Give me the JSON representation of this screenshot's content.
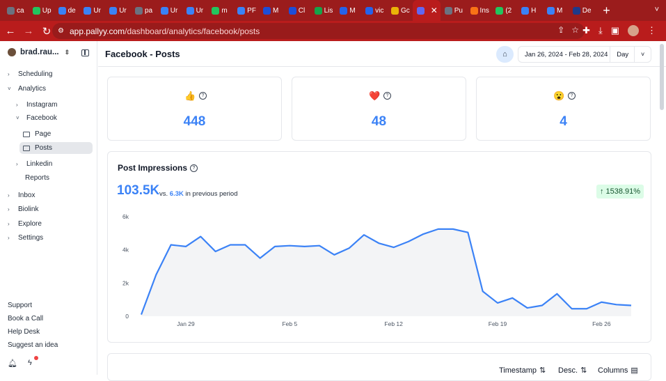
{
  "browser": {
    "tabs": [
      {
        "label": "ca",
        "color": "#6b7280"
      },
      {
        "label": "Up",
        "color": "#22c55e"
      },
      {
        "label": "de",
        "color": "#3b82f6"
      },
      {
        "label": "Ur",
        "color": "#3b82f6"
      },
      {
        "label": "Ur",
        "color": "#3b82f6"
      },
      {
        "label": "pa",
        "color": "#6b7280"
      },
      {
        "label": "Ur",
        "color": "#3b82f6"
      },
      {
        "label": "Ur",
        "color": "#3b82f6"
      },
      {
        "label": "m",
        "color": "#22c55e"
      },
      {
        "label": "PF",
        "color": "#3b82f6"
      },
      {
        "label": "M",
        "color": "#1d4ed8"
      },
      {
        "label": "Cl",
        "color": "#1d4ed8"
      },
      {
        "label": "Lis",
        "color": "#16a34a"
      },
      {
        "label": "M",
        "color": "#2563eb"
      },
      {
        "label": "vic",
        "color": "#2563eb"
      },
      {
        "label": "Gc",
        "color": "#eab308"
      },
      {
        "label": "",
        "color": "#6366f1",
        "active": true
      },
      {
        "label": "Pu",
        "color": "#6b7280"
      },
      {
        "label": "Ins",
        "color": "#f97316"
      },
      {
        "label": "(2",
        "color": "#22c55e"
      },
      {
        "label": "H",
        "color": "#3b82f6"
      },
      {
        "label": "M",
        "color": "#3b82f6"
      },
      {
        "label": "De",
        "color": "#1e3a8a"
      }
    ],
    "url_host": "app.pallyy.com",
    "url_path": "/dashboard/analytics/facebook/posts"
  },
  "sidebar": {
    "account_name": "brad.rau...",
    "items": [
      {
        "label": "Scheduling",
        "chevron": "›"
      },
      {
        "label": "Analytics",
        "chevron": "˅"
      },
      {
        "label": "Instagram",
        "chevron": "›"
      },
      {
        "label": "Facebook",
        "chevron": "˅"
      },
      {
        "label": "Page"
      },
      {
        "label": "Posts"
      },
      {
        "label": "Linkedin",
        "chevron": "›"
      },
      {
        "label": "Reports"
      },
      {
        "label": "Inbox",
        "chevron": "›"
      },
      {
        "label": "Biolink",
        "chevron": "›"
      },
      {
        "label": "Explore",
        "chevron": "›"
      },
      {
        "label": "Settings",
        "chevron": "›"
      }
    ],
    "footer_links": [
      "Support",
      "Book a Call",
      "Help Desk",
      "Suggest an idea"
    ]
  },
  "header": {
    "title": "Facebook - Posts",
    "date_range": "Jan 26, 2024 - Feb 28, 2024",
    "granularity": "Day"
  },
  "reactions": [
    {
      "emoji": "👍",
      "value": "448"
    },
    {
      "emoji": "❤️",
      "value": "48"
    },
    {
      "emoji": "😮",
      "value": "4"
    }
  ],
  "impressions": {
    "title": "Post Impressions",
    "total": "103.5K",
    "vs_label": "vs.",
    "previous": "6.3K",
    "previous_label": "in previous period",
    "growth": "1538.91%"
  },
  "chart_data": {
    "type": "area",
    "title": "",
    "x": [
      "Jan 26",
      "Jan 27",
      "Jan 28",
      "Jan 29",
      "Jan 30",
      "Jan 31",
      "Feb 1",
      "Feb 2",
      "Feb 3",
      "Feb 4",
      "Feb 5",
      "Feb 6",
      "Feb 7",
      "Feb 8",
      "Feb 9",
      "Feb 10",
      "Feb 11",
      "Feb 12",
      "Feb 13",
      "Feb 14",
      "Feb 15",
      "Feb 16",
      "Feb 17",
      "Feb 18",
      "Feb 19",
      "Feb 20",
      "Feb 21",
      "Feb 22",
      "Feb 23",
      "Feb 24",
      "Feb 25",
      "Feb 26",
      "Feb 27",
      "Feb 28"
    ],
    "series": [
      {
        "values": [
          100,
          2500,
          4300,
          4200,
          4800,
          3900,
          4300,
          4300,
          3500,
          4200,
          4250,
          4200,
          4250,
          3700,
          4100,
          4900,
          4400,
          4150,
          4500,
          4950,
          5250,
          5250,
          5050,
          1500,
          800,
          1100,
          500,
          650,
          1350,
          450,
          450,
          850,
          700,
          650
        ]
      }
    ],
    "x_ticks": [
      "Jan 29",
      "Feb 5",
      "Feb 12",
      "Feb 19",
      "Feb 26"
    ],
    "y_ticks": [
      "0",
      "2k",
      "4k",
      "6k"
    ],
    "ylim": [
      0,
      6000
    ],
    "color": "#3b82f6",
    "grid": false
  },
  "table_controls": {
    "sort_label": "Timestamp",
    "order_label": "Desc.",
    "columns_label": "Columns"
  }
}
